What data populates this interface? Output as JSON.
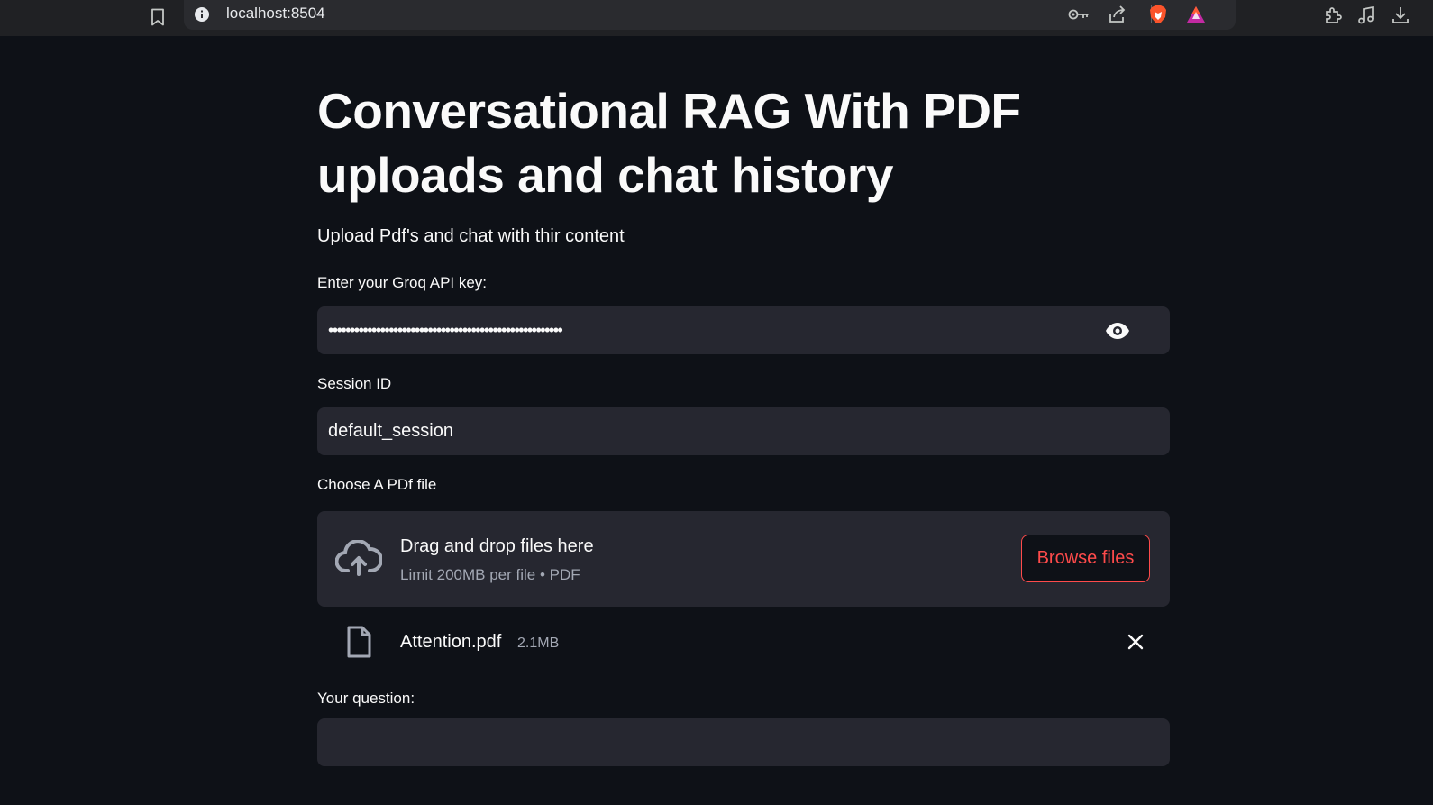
{
  "browser": {
    "url": "localhost:8504",
    "icons": [
      "bookmark-icon",
      "info-icon",
      "key-icon",
      "share-icon",
      "brave-shield-icon",
      "brave-rewards-icon",
      "extensions-icon",
      "media-icon",
      "download-icon"
    ]
  },
  "page": {
    "title": "Conversational RAG With PDF uploads and chat history",
    "subtitle": "Upload Pdf's and chat with thir content"
  },
  "api_key": {
    "label": "Enter your Groq API key:",
    "value": "••••••••••••••••••••••••••••••••••••••••••••••••••••••"
  },
  "session": {
    "label": "Session ID",
    "value": "default_session"
  },
  "uploader": {
    "label": "Choose A PDf file",
    "drop_text": "Drag and drop files here",
    "limit_text": "Limit 200MB per file • PDF",
    "browse_label": "Browse files"
  },
  "uploaded_file": {
    "name": "Attention.pdf",
    "size": "2.1MB"
  },
  "question": {
    "label": "Your question:",
    "value": ""
  },
  "colors": {
    "background": "#0e1117",
    "input_background": "#262730",
    "accent": "#ff4b4b"
  }
}
